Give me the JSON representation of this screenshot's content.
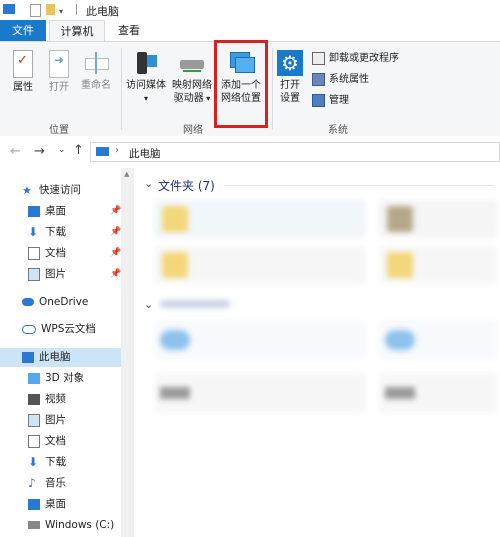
{
  "window": {
    "title": "此电脑"
  },
  "tabs": [
    {
      "label": "文件"
    },
    {
      "label": "计算机"
    },
    {
      "label": "查看"
    }
  ],
  "ribbon": {
    "location_group": {
      "label": "位置",
      "buttons": [
        {
          "label": "属性"
        },
        {
          "label": "打开"
        },
        {
          "label": "重命名"
        }
      ]
    },
    "network_group": {
      "label": "网络",
      "buttons": [
        {
          "label_line1": "访问媒体"
        },
        {
          "label_line1": "映射网络",
          "label_line2": "驱动器"
        },
        {
          "label_line1": "添加一个",
          "label_line2": "网络位置"
        }
      ]
    },
    "system_group": {
      "label": "系统",
      "open_settings": {
        "label_line1": "打开",
        "label_line2": "设置"
      },
      "items": [
        {
          "label": "卸载或更改程序"
        },
        {
          "label": "系统属性"
        },
        {
          "label": "管理"
        }
      ]
    },
    "accent": "#d8211e"
  },
  "address": {
    "path": "此电脑"
  },
  "nav": {
    "quick_access": "快速访问",
    "quick_items": [
      {
        "label": "桌面"
      },
      {
        "label": "下载"
      },
      {
        "label": "文档"
      },
      {
        "label": "图片"
      }
    ],
    "onedrive": "OneDrive",
    "wps": "WPS云文档",
    "this_pc": "此电脑",
    "pc_items": [
      {
        "label": "3D 对象"
      },
      {
        "label": "视频"
      },
      {
        "label": "图片"
      },
      {
        "label": "文档"
      },
      {
        "label": "下载"
      },
      {
        "label": "音乐"
      },
      {
        "label": "桌面"
      },
      {
        "label": "Windows (C:)"
      }
    ]
  },
  "content": {
    "folders_header": "文件夹 (7)"
  }
}
